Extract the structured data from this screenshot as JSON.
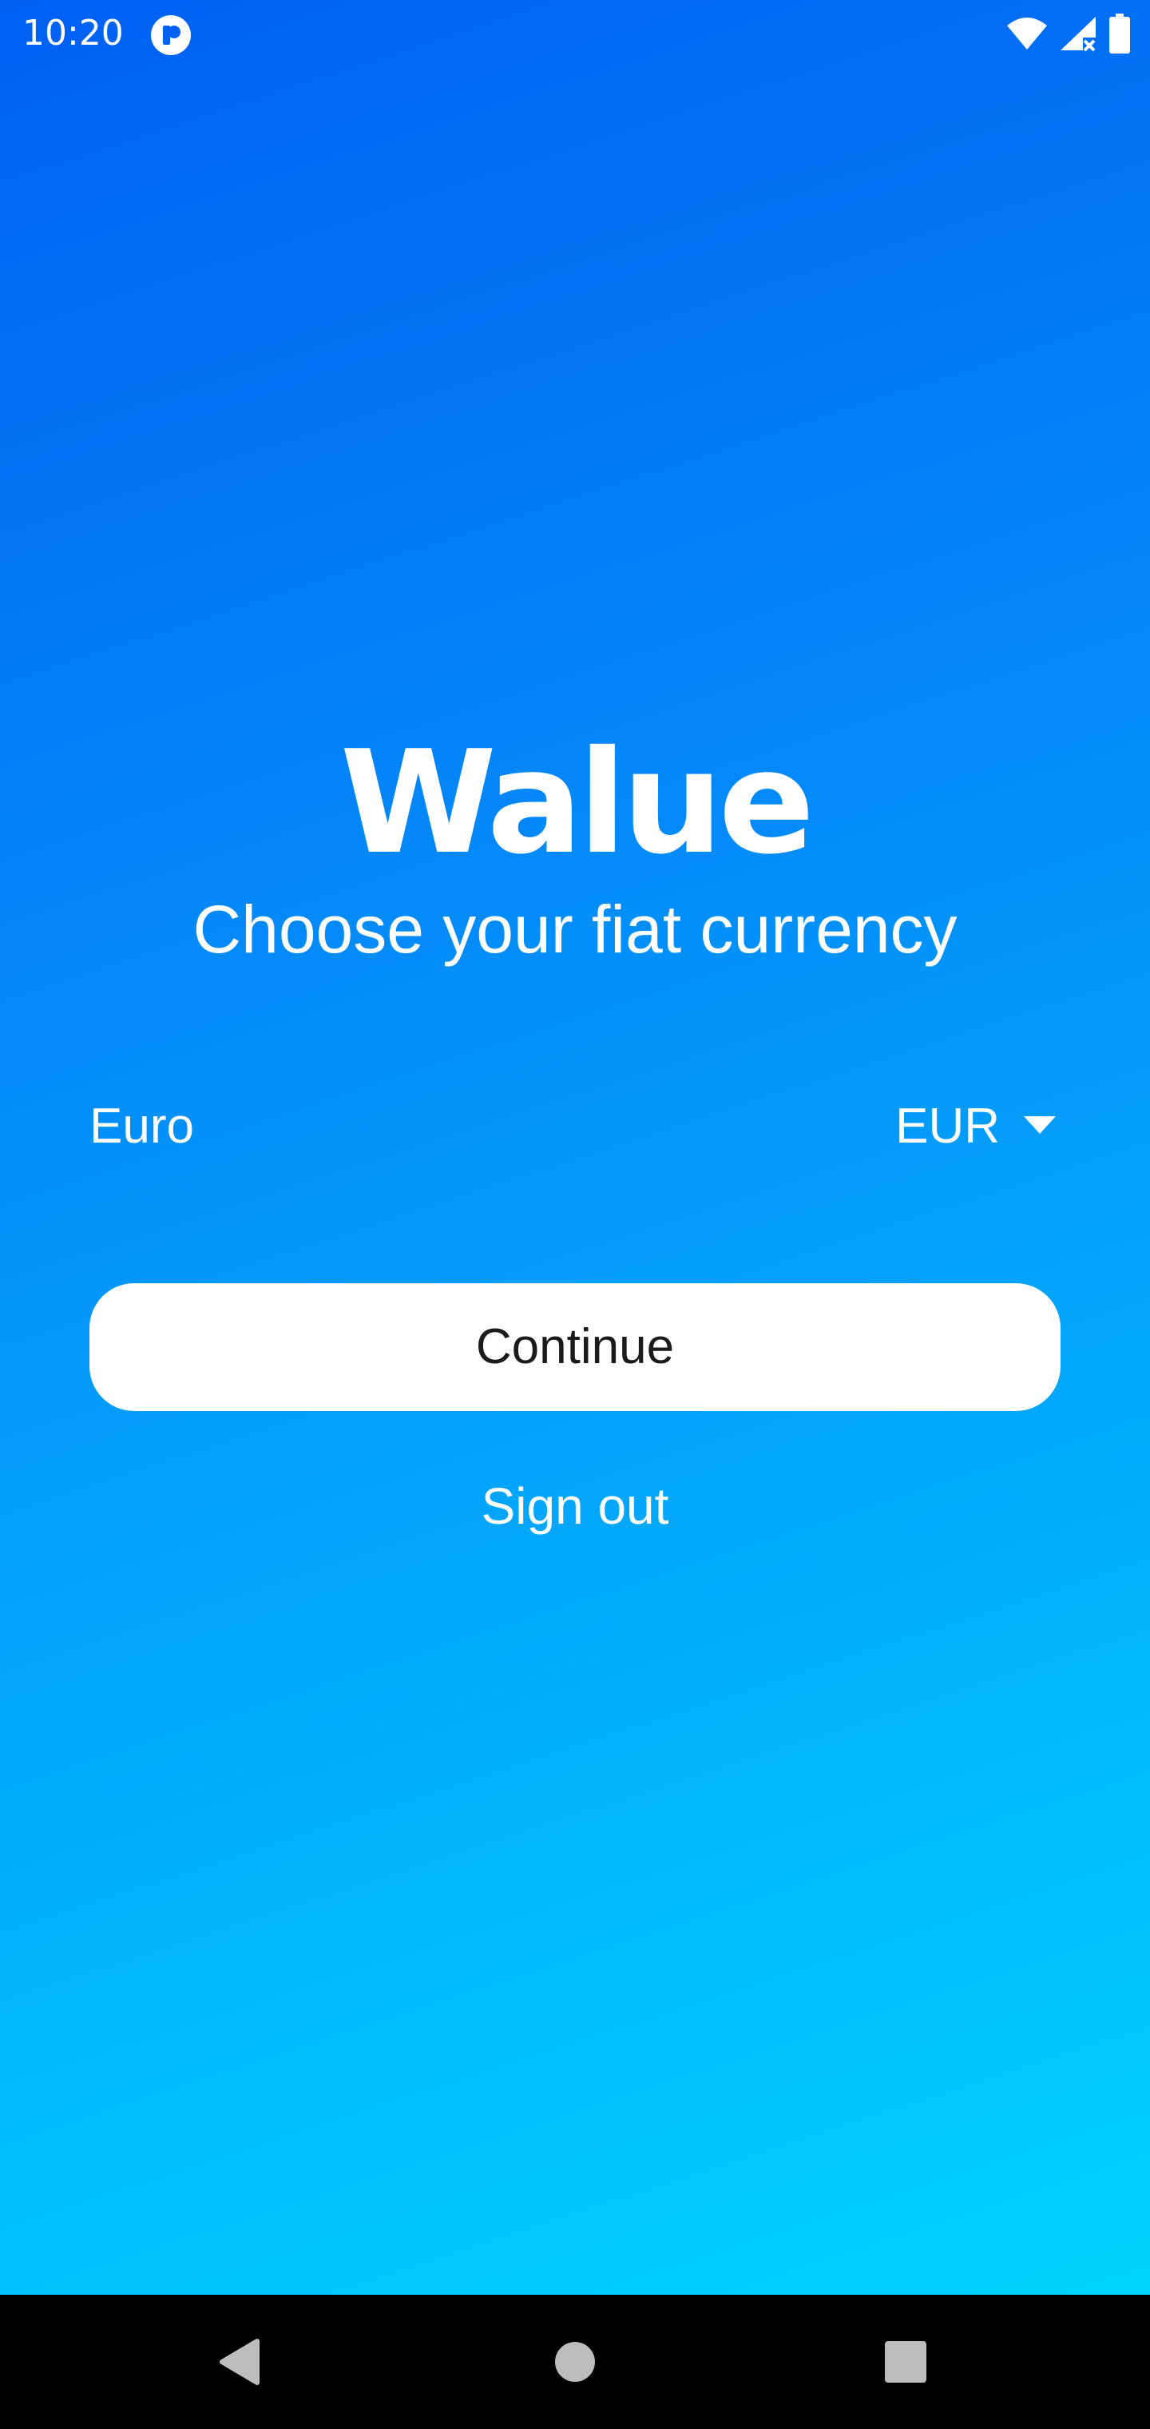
{
  "status_bar": {
    "time": "10:20",
    "app_icon": "circle-app-icon",
    "icons": [
      "wifi-icon",
      "cellular-no-signal-icon",
      "battery-icon"
    ]
  },
  "app": {
    "logo_text": "Walue",
    "subtitle": "Choose your fiat currency"
  },
  "currency": {
    "name": "Euro",
    "code": "EUR",
    "dropdown_icon": "dropdown-arrow-icon"
  },
  "actions": {
    "continue_label": "Continue",
    "signout_label": "Sign out"
  },
  "nav_bar": {
    "buttons": [
      "back-icon",
      "home-icon",
      "recents-icon"
    ]
  },
  "colors": {
    "gradient_top": "#0060f2",
    "gradient_bottom": "#00d4fe",
    "button_bg": "#ffffff",
    "button_text": "#1b1b1b"
  }
}
